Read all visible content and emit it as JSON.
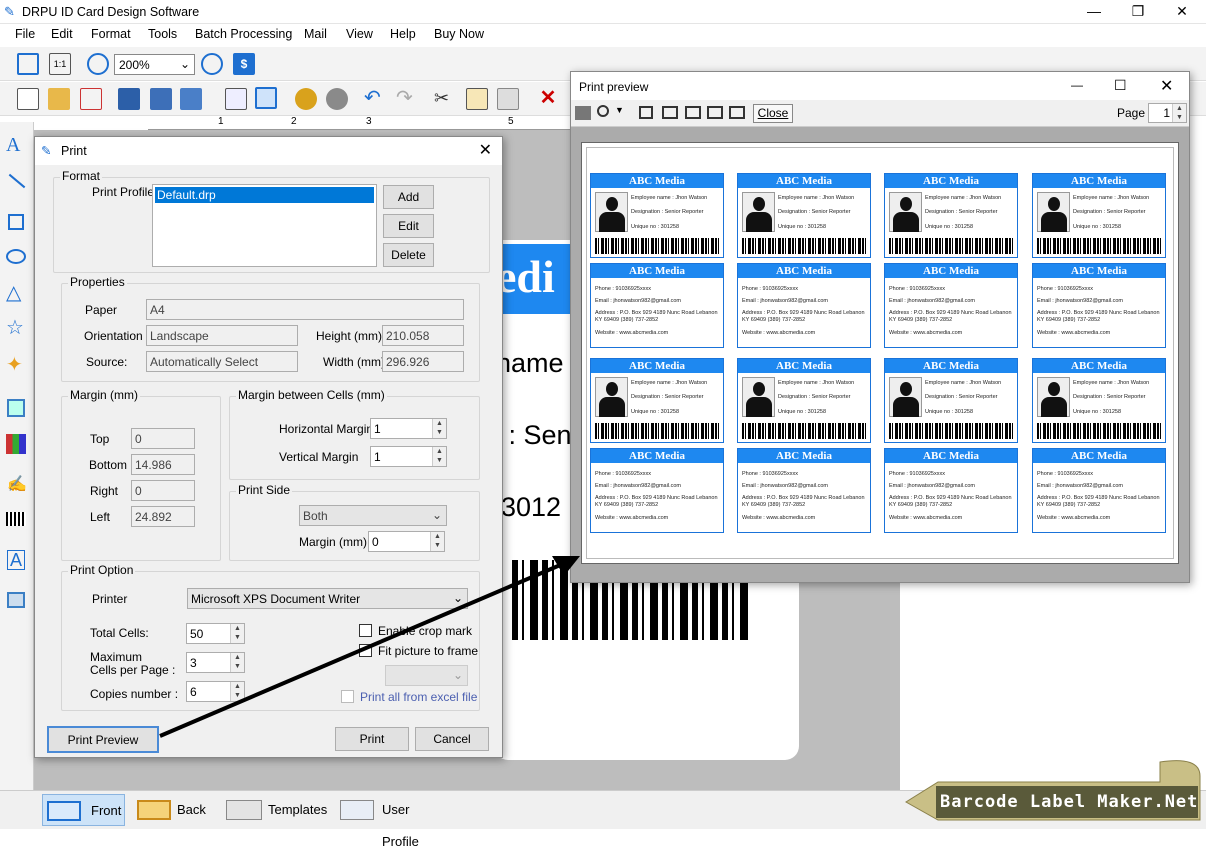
{
  "app": {
    "title": "DRPU ID Card Design Software",
    "zoom": "200%"
  },
  "menu": [
    "File",
    "Edit",
    "Format",
    "Tools",
    "Batch Processing",
    "Mail",
    "View",
    "Help",
    "Buy Now"
  ],
  "ruler": [
    "1",
    "2",
    "3",
    "5"
  ],
  "canvas": {
    "big_text": "edi",
    "name_text": "name",
    "designation_text": "n : Sen",
    "unique_text": ": 3012"
  },
  "print": {
    "title": "Print",
    "format_label": "Format",
    "profile_label": "Print Profile",
    "profile_value": "Default.drp",
    "add": "Add",
    "edit": "Edit",
    "delete": "Delete",
    "properties_label": "Properties",
    "paper_label": "Paper",
    "paper": "A4",
    "orientation_label": "Orientation",
    "orientation": "Landscape",
    "height_label": "Height (mm)",
    "height": "210.058",
    "source_label": "Source:",
    "source": "Automatically Select",
    "width_label": "Width (mm)",
    "width": "296.926",
    "margin_label": "Margin (mm)",
    "top_label": "Top",
    "top": "0",
    "bottom_label": "Bottom",
    "bottom": "14.986",
    "right_label": "Right",
    "right": "0",
    "left_label": "Left",
    "left": "24.892",
    "cells_margin_label": "Margin between Cells (mm)",
    "hmargin_label": "Horizontal Margin",
    "hmargin": "1",
    "vmargin_label": "Vertical Margin",
    "vmargin": "1",
    "print_side_label": "Print Side",
    "print_side": "Both",
    "side_margin_label": "Margin (mm)",
    "side_margin": "0",
    "print_option_label": "Print Option",
    "printer_label": "Printer",
    "printer": "Microsoft XPS Document Writer",
    "total_cells_label": "Total Cells:",
    "total_cells": "50",
    "max_cells_label1": "Maximum",
    "max_cells_label2": "Cells per Page :",
    "max_cells": "3",
    "copies_label": "Copies number :",
    "copies": "6",
    "crop_mark": "Enable crop mark",
    "fit_picture": "Fit picture to frame",
    "print_all_excel": "Print all from excel file",
    "preview_btn": "Print Preview",
    "print_btn": "Print",
    "cancel_btn": "Cancel"
  },
  "preview": {
    "title": "Print preview",
    "close": "Close",
    "page_label": "Page",
    "page": "1"
  },
  "card": {
    "brand": "ABC Media",
    "employee": "Employee name : Jhon Watson",
    "designation": "Designation : Senior Reporter",
    "unique": "Unique no : 301258",
    "phone": "Phone : 91036925xxxx",
    "email": "Email : jhonwatson982@gmail.com",
    "address1": "Address : P.O. Box 929 4189 Nunc Road Lebanon",
    "address2": "KY 69409 (389) 737-2852",
    "website": "Website : www.abcmedia.com"
  },
  "bottom_tabs": [
    "Front",
    "Back",
    "Templates",
    "User Profile"
  ],
  "brand_banner": "Barcode Label Maker.Net",
  "colors": {
    "accent": "#1e88f0",
    "selection": "#0078d7"
  }
}
